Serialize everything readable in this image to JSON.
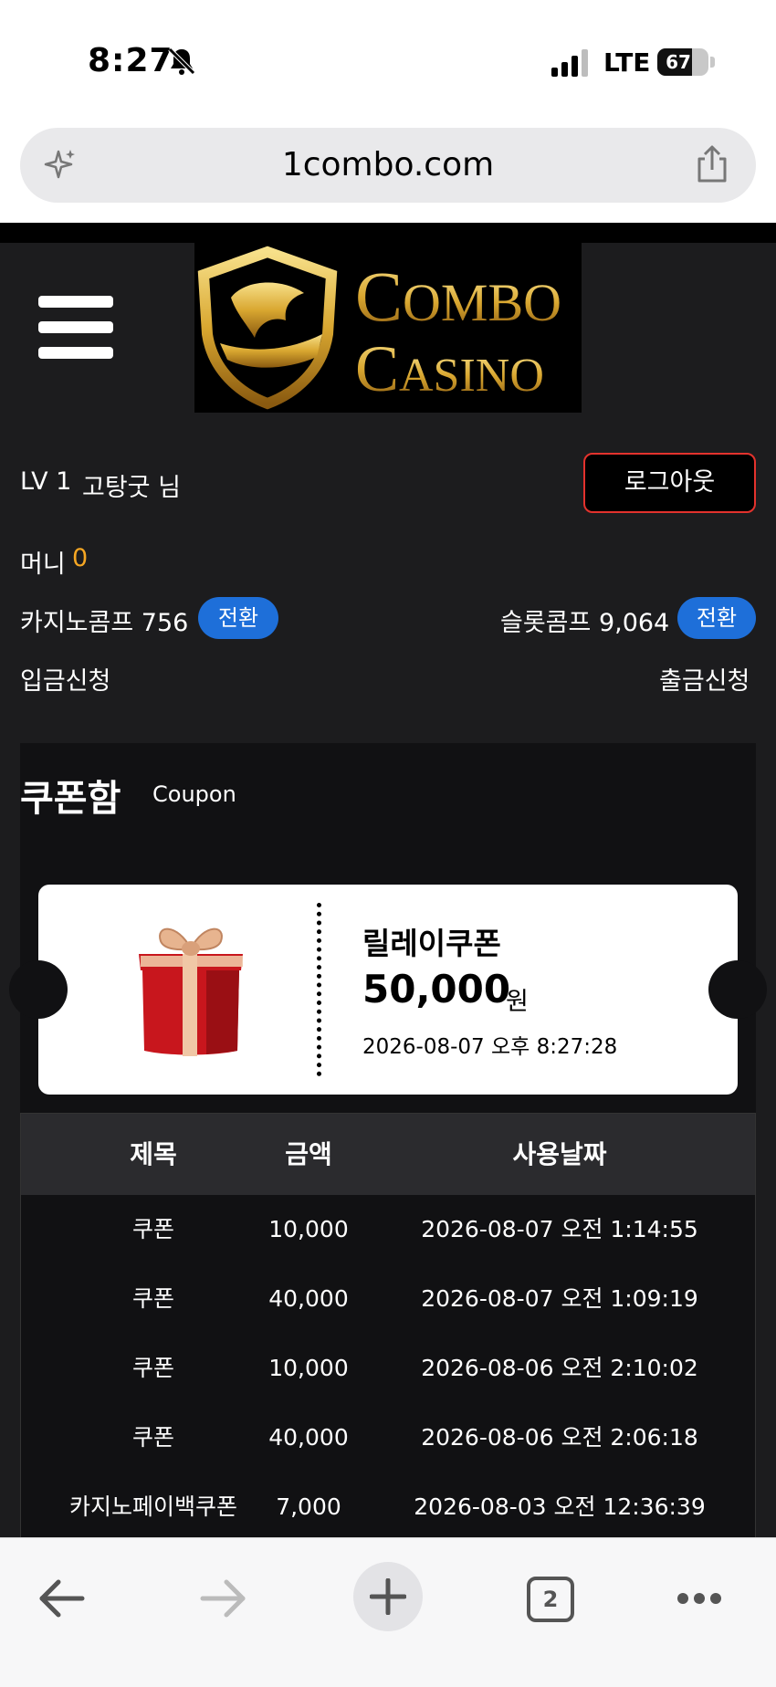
{
  "status_bar": {
    "time": "8:27",
    "network": "LTE",
    "battery": "67",
    "battery_level": 0.67
  },
  "browser": {
    "url": "1combo.com",
    "tab_count": "2"
  },
  "header": {
    "logo_text": "COMBO CASINO"
  },
  "user": {
    "level": "LV 1",
    "name": "고탕굿 님",
    "logout_label": "로그아웃",
    "money_label": "머니",
    "money_value": "0",
    "casino_comp": "카지노콤프 756",
    "slot_comp": "슬롯콤프 9,064",
    "convert_label": "전환",
    "deposit_label": "입금신청",
    "withdraw_label": "출금신청"
  },
  "coupon_box": {
    "title": "쿠폰함",
    "subtitle": "Coupon",
    "ticket": {
      "name": "릴레이쿠폰",
      "amount": "50,000",
      "unit": "원",
      "date": "2026-08-07 오후 8:27:28"
    },
    "table": {
      "headers": [
        "제목",
        "금액",
        "사용날짜"
      ],
      "rows": [
        {
          "title": "쿠폰",
          "amount": "10,000",
          "date": "2026-08-07 오전 1:14:55"
        },
        {
          "title": "쿠폰",
          "amount": "40,000",
          "date": "2026-08-07 오전 1:09:19"
        },
        {
          "title": "쿠폰",
          "amount": "10,000",
          "date": "2026-08-06 오전 2:10:02"
        },
        {
          "title": "쿠폰",
          "amount": "40,000",
          "date": "2026-08-06 오전 2:06:18"
        },
        {
          "title": "카지노페이백쿠폰",
          "amount": "7,000",
          "date": "2026-08-03 오전 12:36:39"
        }
      ]
    }
  },
  "colors": {
    "page_bg": "#1c1c1e",
    "accent_blue": "#1e6fd9",
    "money_orange": "#f5a623",
    "logout_border": "#e3322d",
    "logo_gold": "#d9a730"
  }
}
